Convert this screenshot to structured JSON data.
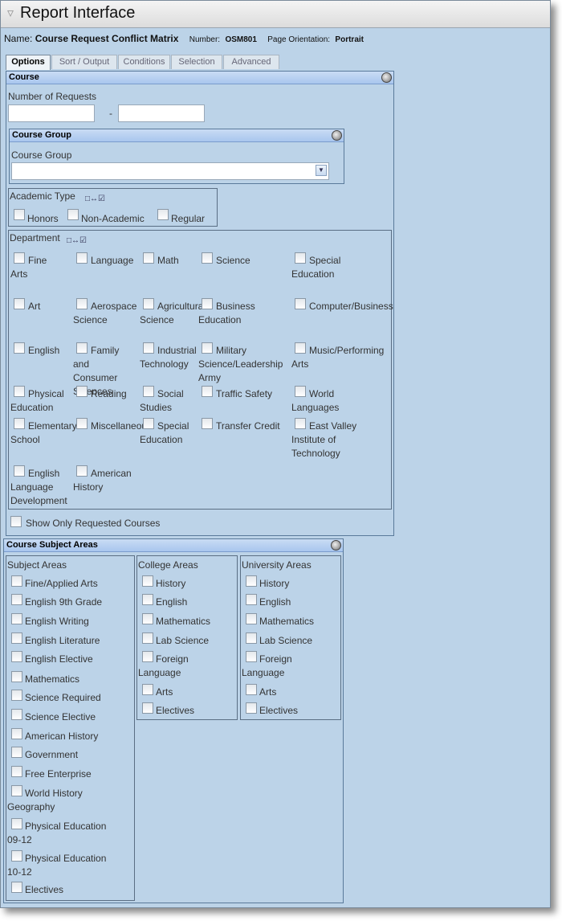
{
  "title": "Report Interface",
  "report": {
    "name_label": "Name:",
    "name_value": "Course Request Conflict Matrix",
    "number_label": "Number:",
    "number_value": "OSM801",
    "orientation_label": "Page Orientation:",
    "orientation_value": "Portrait"
  },
  "tabs": [
    "Options",
    "Sort / Output",
    "Conditions",
    "Selection",
    "Advanced"
  ],
  "course": {
    "header": "Course",
    "num_requests_label": "Number of Requests",
    "dash": "-",
    "course_group": {
      "header": "Course Group",
      "label": "Course Group"
    },
    "academic_type": {
      "label": "Academic Type",
      "options": [
        "Honors",
        "Non-Academic",
        "Regular"
      ]
    },
    "department": {
      "label": "Department",
      "items": [
        "Fine\nArts",
        "Language",
        "Math",
        "Science",
        "Special\nEducation",
        "Art",
        "Aerospace\nScience",
        "Agricultural\nScience",
        "Business\nEducation",
        "Computer/Business",
        "English",
        "Family\nand\nConsumer\nSciences",
        "Industrial\nTechnology",
        "Military\nScience/Leadership\nArmy",
        "Music/Performing\nArts",
        "Physical\nEducation",
        "Reading",
        "Social\nStudies",
        "Traffic Safety",
        "World\nLanguages",
        "Elementary\nSchool",
        "Miscellaneous",
        "Special\nEducation",
        "Transfer Credit",
        "East Valley\nInstitute of\nTechnology",
        "English\nLanguage\nDevelopment",
        "American\nHistory"
      ]
    },
    "show_only": "Show Only Requested Courses"
  },
  "subject_areas": {
    "header": "Course Subject Areas",
    "subject": {
      "title": "Subject Areas",
      "items": [
        "Fine/Applied Arts",
        "English 9th Grade",
        "English Writing",
        "English Literature",
        "English Elective",
        "Mathematics",
        "Science Required",
        "Science Elective",
        "American History",
        "Government",
        "Free Enterprise",
        "World History\nGeography",
        "Physical Education\n09-12",
        "Physical Education\n10-12",
        "Electives"
      ]
    },
    "college": {
      "title": "College Areas",
      "items": [
        "History",
        "English",
        "Mathematics",
        "Lab Science",
        "Foreign\nLanguage",
        "Arts",
        "Electives"
      ]
    },
    "university": {
      "title": "University Areas",
      "items": [
        "History",
        "English",
        "Mathematics",
        "Lab Science",
        "Foreign\nLanguage",
        "Arts",
        "Electives"
      ]
    }
  }
}
